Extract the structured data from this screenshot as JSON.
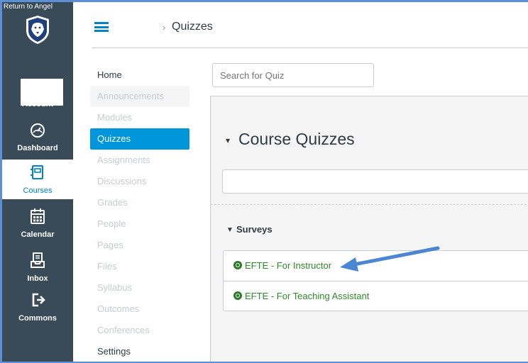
{
  "global_nav": {
    "return_label": "Return to Angel",
    "items": [
      {
        "label": "Account",
        "icon": "avatar"
      },
      {
        "label": "Dashboard",
        "icon": "dashboard-icon"
      },
      {
        "label": "Courses",
        "icon": "courses-icon"
      },
      {
        "label": "Calendar",
        "icon": "calendar-icon"
      },
      {
        "label": "Inbox",
        "icon": "inbox-icon"
      },
      {
        "label": "Commons",
        "icon": "commons-icon"
      }
    ]
  },
  "header": {
    "breadcrumb_separator": "›",
    "breadcrumb": "Quizzes"
  },
  "course_nav": [
    {
      "label": "Home"
    },
    {
      "label": "Announcements"
    },
    {
      "label": "Modules"
    },
    {
      "label": "Quizzes"
    },
    {
      "label": "Assignments"
    },
    {
      "label": "Discussions"
    },
    {
      "label": "Grades"
    },
    {
      "label": "People"
    },
    {
      "label": "Pages"
    },
    {
      "label": "Files"
    },
    {
      "label": "Syllabus"
    },
    {
      "label": "Outcomes"
    },
    {
      "label": "Conferences"
    },
    {
      "label": "Settings"
    }
  ],
  "search": {
    "placeholder": "Search for Quiz"
  },
  "course_quizzes": {
    "caret": "▾",
    "title": "Course Quizzes"
  },
  "surveys": {
    "caret": "▼",
    "title": "Surveys",
    "items": [
      {
        "label": "EFTE - For Instructor"
      },
      {
        "label": "EFTE - For Teaching Assistant"
      }
    ]
  },
  "colors": {
    "accent": "#0096db",
    "nav_bg": "#394b58",
    "link_green": "#2f8a2a",
    "arrow": "#4a86d1"
  }
}
